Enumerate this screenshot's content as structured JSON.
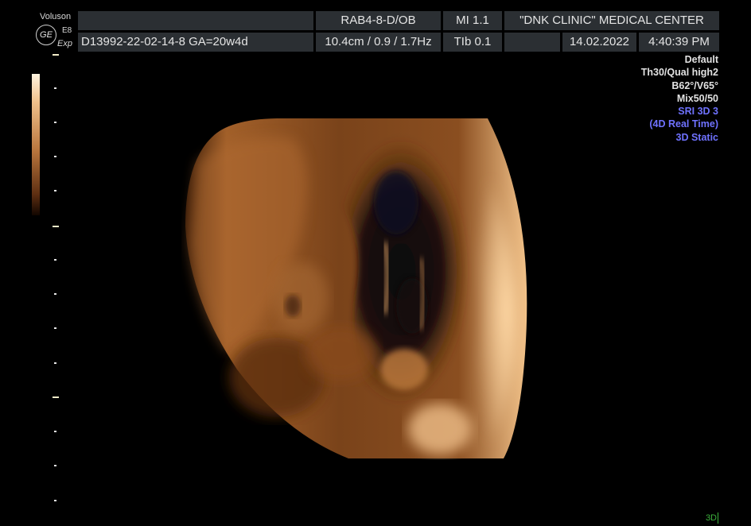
{
  "header": {
    "brand": "Voluson",
    "model": "E8",
    "mode": "Exp",
    "logo_text": "GE",
    "probe": "RAB4-8-D/OB",
    "mi": "MI  1.1",
    "clinic": "\"DNK CLINIC\" MEDICAL CENTER",
    "patient_id": "D13992-22-02-14-8  GA=20w4d",
    "acq_params": "10.4cm / 0.9 / 1.7Hz",
    "tib": "TIb  0.1",
    "date": "14.02.2022",
    "time": "4:40:39 PM"
  },
  "params": {
    "preset": "Default",
    "quality": "Th30/Qual high2",
    "angles": "B62°/V65°",
    "mix": "Mix50/50",
    "sri": "SRI 3D 3",
    "realtime": "(4D Real Time)",
    "static": "3D Static"
  },
  "footer": {
    "mode_tag": "3D"
  },
  "colors": {
    "header_bg": "#2b2f33",
    "accent_blue": "#6f72ff",
    "tag_green": "#3db23d",
    "sepia": "#b7743c"
  },
  "scale": {
    "depth_cm": 10.4
  }
}
